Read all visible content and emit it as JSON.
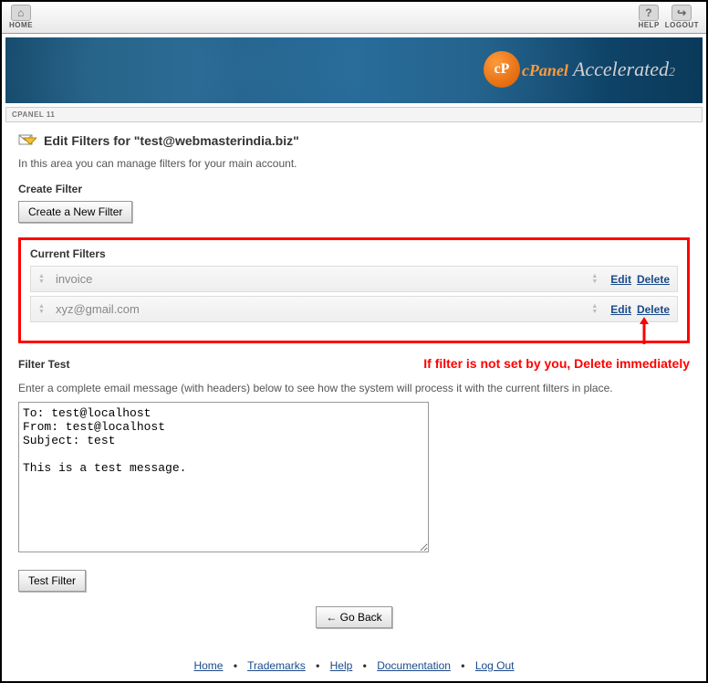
{
  "topbar": {
    "home": "HOME",
    "help": "HELP",
    "logout": "LOGOUT"
  },
  "banner": {
    "cp": "cP",
    "cpanel": "cPanel",
    "accelerated": "Accelerated",
    "sub": "2"
  },
  "breadcrumb": "CPANEL 11",
  "page": {
    "title": "Edit Filters for \"test@webmasterindia.biz\"",
    "intro": "In this area you can manage filters for your main account."
  },
  "create": {
    "heading": "Create Filter",
    "button": "Create a New Filter"
  },
  "current": {
    "heading": "Current Filters",
    "edit": "Edit",
    "delete": "Delete",
    "filters": [
      {
        "name": "invoice"
      },
      {
        "name": "xyz@gmail.com"
      }
    ]
  },
  "annotation": "If filter is not set by you, Delete immediately",
  "test": {
    "heading": "Filter Test",
    "desc": "Enter a complete email message (with headers) below to see how the system will process it with the current filters in place.",
    "body": "To: test@localhost\nFrom: test@localhost\nSubject: test\n\nThis is a test message.",
    "button": "Test Filter"
  },
  "goback": "← Go Back",
  "footer": {
    "links": [
      "Home",
      "Trademarks",
      "Help",
      "Documentation",
      "Log Out"
    ]
  }
}
